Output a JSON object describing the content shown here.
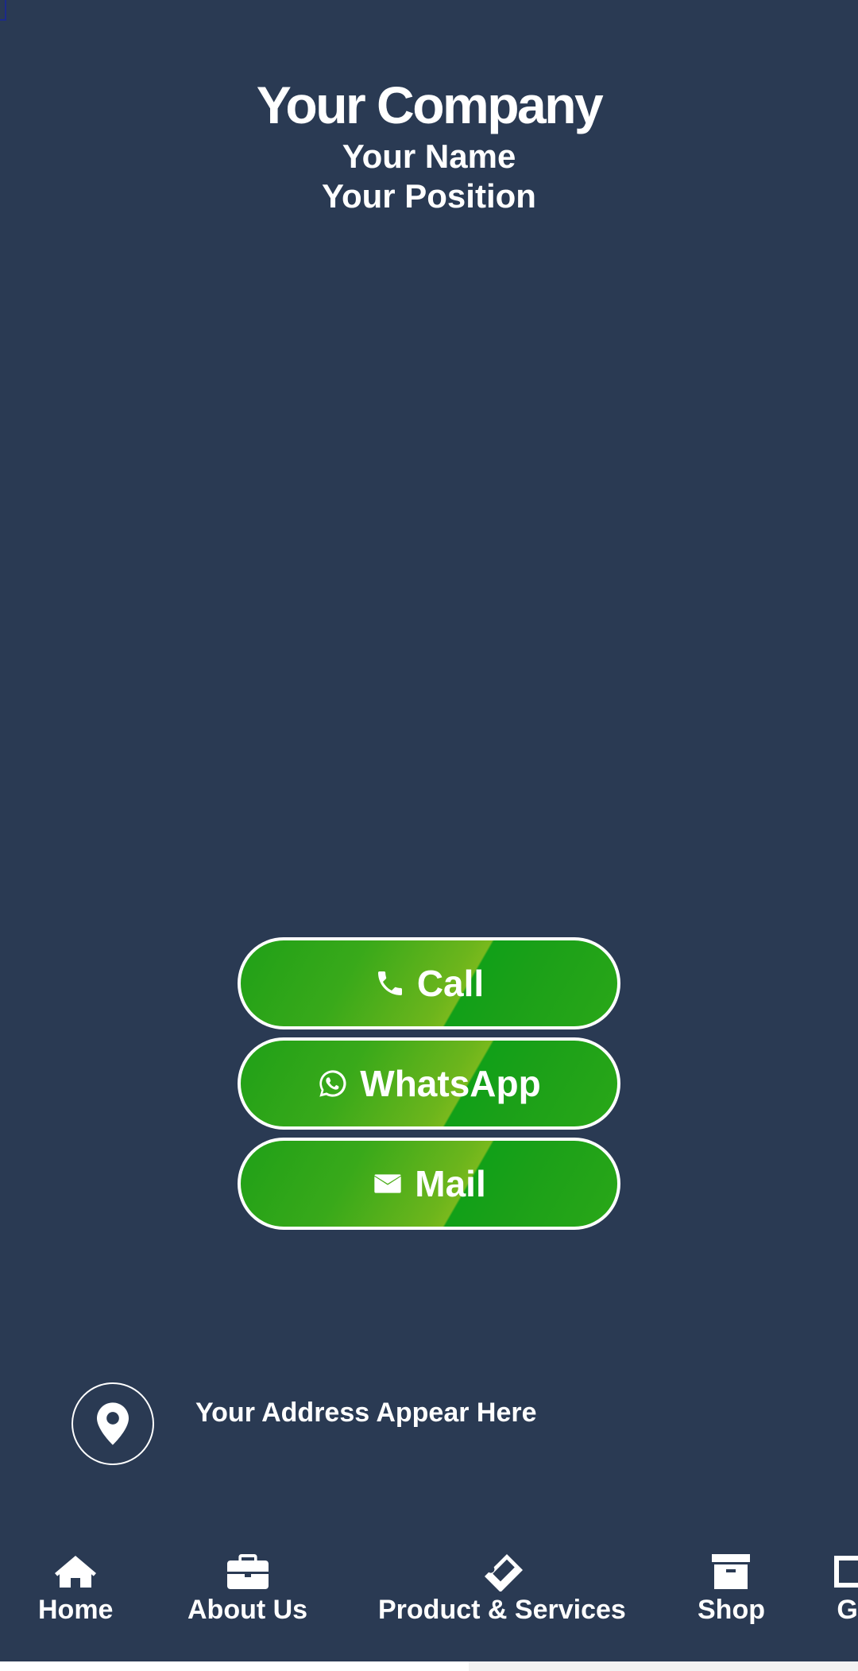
{
  "header": {
    "company": "Your Company",
    "name": "Your Name",
    "position": "Your Position"
  },
  "actions": [
    {
      "label": "Call",
      "icon": "phone-icon"
    },
    {
      "label": "WhatsApp",
      "icon": "whatsapp-icon"
    },
    {
      "label": "Mail",
      "icon": "envelope-icon"
    }
  ],
  "address": {
    "text": "Your Address Appear Here",
    "icon": "map-pin-icon"
  },
  "nav": [
    {
      "label": "Home",
      "icon": "home-icon"
    },
    {
      "label": "About Us",
      "icon": "briefcase-icon"
    },
    {
      "label": "Product & Services",
      "icon": "ticket-icon"
    },
    {
      "label": "Shop",
      "icon": "archive-icon"
    },
    {
      "label": "Ga",
      "icon": "gallery-icon"
    }
  ],
  "colors": {
    "background": "#2a3a53",
    "button_green": "#1fa017",
    "button_light_green": "#79b91d",
    "text": "#ffffff"
  }
}
